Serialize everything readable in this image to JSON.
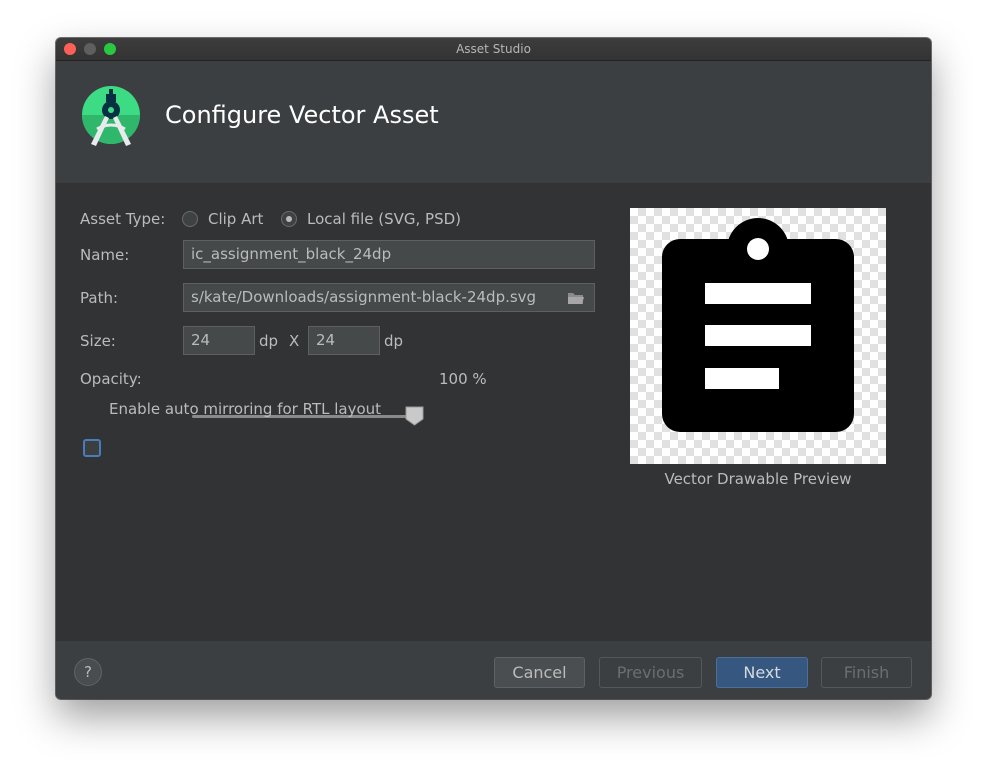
{
  "window": {
    "title": "Asset Studio"
  },
  "header": {
    "title": "Configure Vector Asset",
    "logo_icon": "android-studio-icon"
  },
  "form": {
    "asset_type": {
      "label": "Asset Type:",
      "options": [
        "Clip Art",
        "Local file (SVG, PSD)"
      ],
      "selected": "Local file (SVG, PSD)"
    },
    "name": {
      "label": "Name:",
      "value": "ic_assignment_black_24dp"
    },
    "path": {
      "label": "Path:",
      "value": "s/kate/Downloads/assignment-black-24dp.svg",
      "icon": "folder-icon"
    },
    "size": {
      "label": "Size:",
      "width": "24",
      "width_unit": "dp",
      "separator": "X",
      "height": "24",
      "height_unit": "dp"
    },
    "opacity": {
      "label": "Opacity:",
      "value_text": "100 %",
      "value": 100
    },
    "auto_mirror": {
      "label": "Enable auto mirroring for RTL layout",
      "checked": false
    }
  },
  "preview": {
    "caption": "Vector Drawable Preview",
    "icon": "assignment-icon"
  },
  "footer": {
    "help_label": "?",
    "cancel": "Cancel",
    "previous": "Previous",
    "next": "Next",
    "finish": "Finish"
  },
  "colors": {
    "accent": "#365880",
    "background": "#3c3f41",
    "panel": "#313335",
    "text": "#bbbbbb"
  }
}
